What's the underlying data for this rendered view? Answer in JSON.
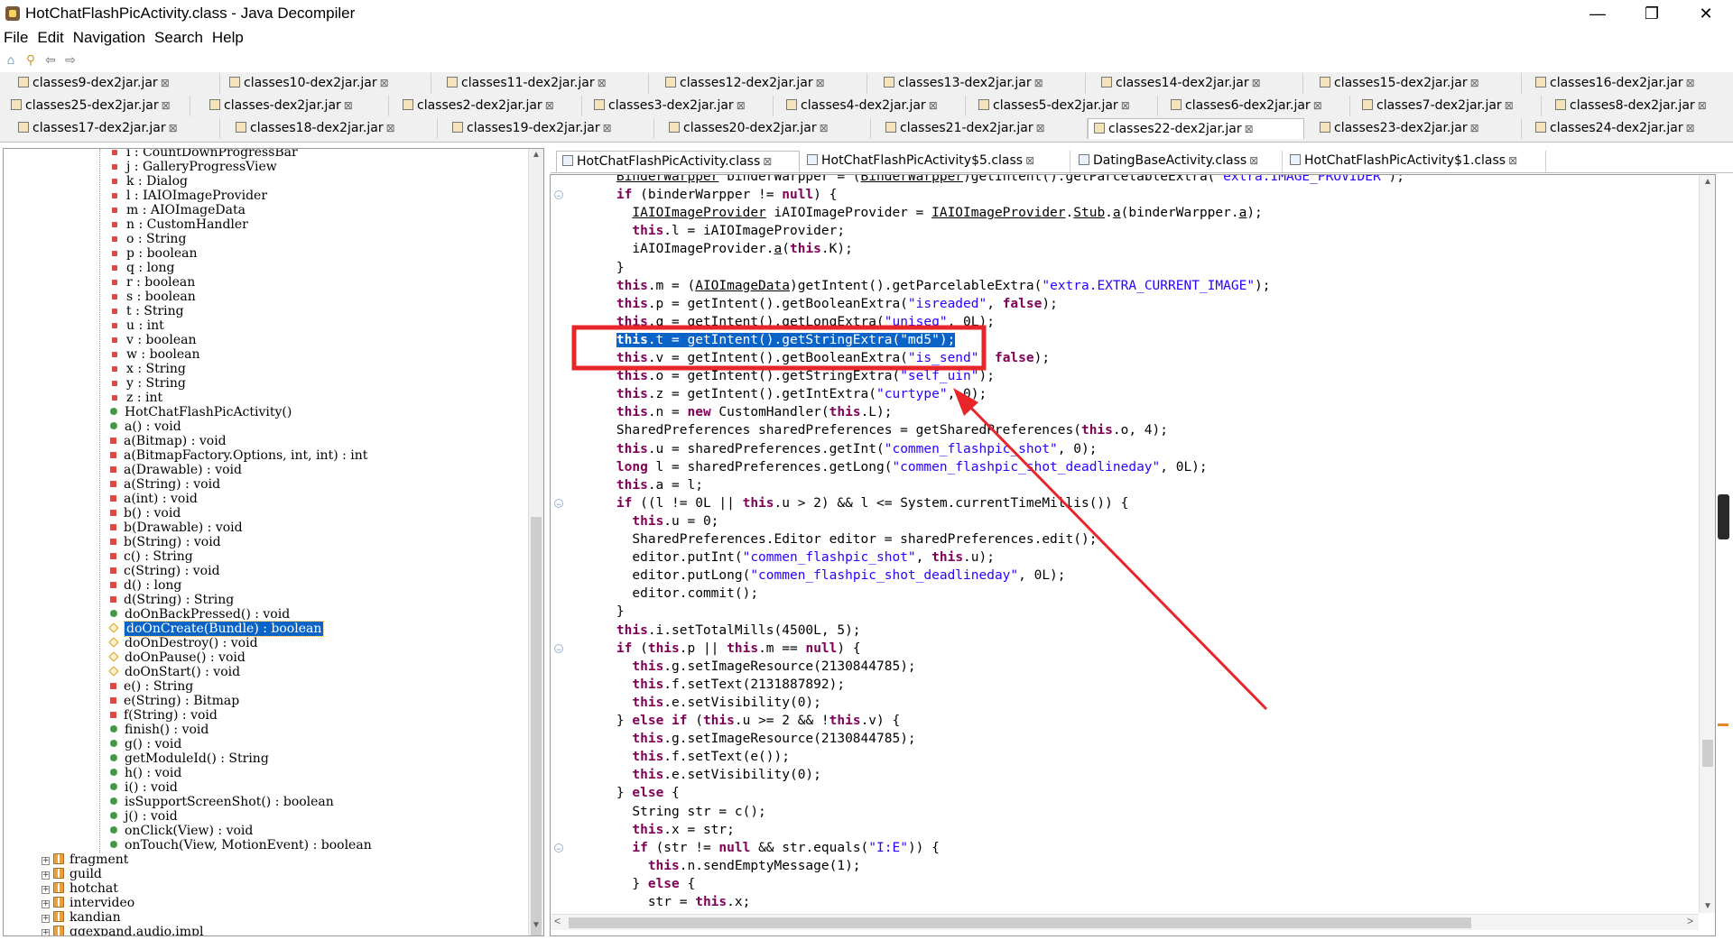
{
  "window": {
    "title": "HotChatFlashPicActivity.class - Java Decompiler",
    "minimize": "—",
    "maximize": "❐",
    "close": "✕"
  },
  "menu": [
    "File",
    "Edit",
    "Navigation",
    "Search",
    "Help"
  ],
  "toolbar": {
    "icons": [
      "open-file-icon",
      "open-folder-icon",
      "back-icon",
      "forward-icon"
    ],
    "glyphs": [
      "⌂",
      "⚲",
      "⇦",
      "⇨"
    ]
  },
  "jar_tabs": {
    "row1": [
      "classes9-dex2jar.jar",
      "classes10-dex2jar.jar",
      "classes11-dex2jar.jar",
      "classes12-dex2jar.jar",
      "classes13-dex2jar.jar",
      "classes14-dex2jar.jar",
      "classes15-dex2jar.jar",
      "classes16-dex2jar.jar"
    ],
    "row2": [
      "classes25-dex2jar.jar",
      "classes-dex2jar.jar",
      "classes2-dex2jar.jar",
      "classes3-dex2jar.jar",
      "classes4-dex2jar.jar",
      "classes5-dex2jar.jar",
      "classes6-dex2jar.jar",
      "classes7-dex2jar.jar",
      "classes8-dex2jar.jar"
    ],
    "row3": [
      "classes17-dex2jar.jar",
      "classes18-dex2jar.jar",
      "classes19-dex2jar.jar",
      "classes20-dex2jar.jar",
      "classes21-dex2jar.jar",
      "classes22-dex2jar.jar",
      "classes23-dex2jar.jar",
      "classes24-dex2jar.jar"
    ],
    "active": "classes22-dex2jar.jar",
    "close_glyph": "⊠"
  },
  "tree": {
    "members": [
      {
        "kind": "field",
        "text": "i : CountDownProgressBar"
      },
      {
        "kind": "field",
        "text": "j : GalleryProgressView"
      },
      {
        "kind": "field",
        "text": "k : Dialog"
      },
      {
        "kind": "field",
        "text": "l : IAIOImageProvider"
      },
      {
        "kind": "field",
        "text": "m : AIOImageData"
      },
      {
        "kind": "field",
        "text": "n : CustomHandler"
      },
      {
        "kind": "field",
        "text": "o : String"
      },
      {
        "kind": "field",
        "text": "p : boolean"
      },
      {
        "kind": "field",
        "text": "q : long"
      },
      {
        "kind": "field",
        "text": "r : boolean"
      },
      {
        "kind": "field",
        "text": "s : boolean"
      },
      {
        "kind": "field",
        "text": "t : String"
      },
      {
        "kind": "field",
        "text": "u : int"
      },
      {
        "kind": "field",
        "text": "v : boolean"
      },
      {
        "kind": "field",
        "text": "w : boolean"
      },
      {
        "kind": "field",
        "text": "x : String"
      },
      {
        "kind": "field",
        "text": "y : String"
      },
      {
        "kind": "field",
        "text": "z : int"
      },
      {
        "kind": "pub",
        "text": "HotChatFlashPicActivity()"
      },
      {
        "kind": "pub",
        "text": "a() : void"
      },
      {
        "kind": "priv",
        "text": "a(Bitmap) : void"
      },
      {
        "kind": "priv",
        "text": "a(BitmapFactory.Options, int, int) : int"
      },
      {
        "kind": "priv",
        "text": "a(Drawable) : void"
      },
      {
        "kind": "priv",
        "text": "a(String) : void"
      },
      {
        "kind": "priv",
        "text": "a(int) : void"
      },
      {
        "kind": "priv",
        "text": "b() : void"
      },
      {
        "kind": "priv",
        "text": "b(Drawable) : void"
      },
      {
        "kind": "priv",
        "text": "b(String) : void"
      },
      {
        "kind": "priv",
        "text": "c() : String"
      },
      {
        "kind": "priv",
        "text": "c(String) : void"
      },
      {
        "kind": "priv",
        "text": "d() : long"
      },
      {
        "kind": "priv",
        "text": "d(String) : String"
      },
      {
        "kind": "pub",
        "text": "doOnBackPressed() : void"
      },
      {
        "kind": "prot",
        "text": "doOnCreate(Bundle) : boolean",
        "selected": true
      },
      {
        "kind": "prot",
        "text": "doOnDestroy() : void"
      },
      {
        "kind": "prot",
        "text": "doOnPause() : void"
      },
      {
        "kind": "prot",
        "text": "doOnStart() : void"
      },
      {
        "kind": "priv",
        "text": "e() : String"
      },
      {
        "kind": "priv",
        "text": "e(String) : Bitmap"
      },
      {
        "kind": "priv",
        "text": "f(String) : void"
      },
      {
        "kind": "pub",
        "text": "finish() : void"
      },
      {
        "kind": "pub",
        "text": "g() : void"
      },
      {
        "kind": "pub",
        "text": "getModuleId() : String"
      },
      {
        "kind": "pub",
        "text": "h() : void"
      },
      {
        "kind": "pub",
        "text": "i() : void"
      },
      {
        "kind": "pub",
        "text": "isSupportScreenShot() : boolean"
      },
      {
        "kind": "pub",
        "text": "j() : void"
      },
      {
        "kind": "pub",
        "text": "onClick(View) : void"
      },
      {
        "kind": "pub",
        "text": "onTouch(View, MotionEvent) : boolean"
      }
    ],
    "packages": [
      "fragment",
      "guild",
      "hotchat",
      "intervideo",
      "kandian",
      "qqexpand.audio.impl"
    ],
    "expander": "+"
  },
  "editor_tabs": [
    {
      "label": "HotChatFlashPicActivity.class",
      "active": true
    },
    {
      "label": "HotChatFlashPicActivity$5.class",
      "active": false
    },
    {
      "label": "DatingBaseActivity.class",
      "active": false
    },
    {
      "label": "HotChatFlashPicActivity$1.class",
      "active": false
    }
  ],
  "code": [
    {
      "indent": 4,
      "fold": false,
      "html": "<span class=\"ul\">BinderWarpper</span> binderWarpper = (<span class=\"ul\">BinderWarpper</span>)getIntent().getParcelableExtra(<span class=\"str\">\"extra.IMAGE_PROVIDER\"</span>);"
    },
    {
      "indent": 4,
      "fold": true,
      "html": "<span class=\"kw\">if</span> (binderWarpper != <span class=\"kw\">null</span>) {"
    },
    {
      "indent": 6,
      "fold": false,
      "html": "<span class=\"ul\">IAIOImageProvider</span> iAIOImageProvider = <span class=\"ul\">IAIOImageProvider</span>.<span class=\"ul\">Stub</span>.<span class=\"ul\">a</span>(binderWarpper.<span class=\"ul\">a</span>);"
    },
    {
      "indent": 6,
      "fold": false,
      "html": "<span class=\"kw\">this</span>.l = iAIOImageProvider;"
    },
    {
      "indent": 6,
      "fold": false,
      "html": "iAIOImageProvider.<span class=\"ul\">a</span>(<span class=\"kw\">this</span>.K);"
    },
    {
      "indent": 4,
      "fold": false,
      "html": "}"
    },
    {
      "indent": 4,
      "fold": false,
      "html": "<span class=\"kw\">this</span>.m = (<span class=\"ul\">AIOImageData</span>)getIntent().getParcelableExtra(<span class=\"str\">\"extra.EXTRA_CURRENT_IMAGE\"</span>);"
    },
    {
      "indent": 4,
      "fold": false,
      "html": "<span class=\"kw\">this</span>.p = getIntent().getBooleanExtra(<span class=\"str\">\"isreaded\"</span>, <span class=\"kw\">false</span>);"
    },
    {
      "indent": 4,
      "fold": false,
      "html": "<span class=\"kw\">this</span>.q = getIntent().getLongExtra(<span class=\"str\">\"uniseq\"</span>, 0L);"
    },
    {
      "indent": 4,
      "fold": false,
      "sel": true,
      "html": "<span class=\"sel-span\"><span class=\"kw\">this</span>.t = getIntent().getStringExtra(<span class=\"str\">\"md5\"</span>);</span>"
    },
    {
      "indent": 4,
      "fold": false,
      "html": "<span class=\"kw\">this</span>.v = getIntent().getBooleanExtra(<span class=\"str\">\"is_send\"</span>, <span class=\"kw\">false</span>);"
    },
    {
      "indent": 4,
      "fold": false,
      "html": "<span class=\"kw\">this</span>.o = getIntent().getStringExtra(<span class=\"str\">\"self_uin\"</span>);"
    },
    {
      "indent": 4,
      "fold": false,
      "html": "<span class=\"kw\">this</span>.z = getIntent().getIntExtra(<span class=\"str\">\"curtype\"</span>, 0);"
    },
    {
      "indent": 4,
      "fold": false,
      "html": "<span class=\"kw\">this</span>.n = <span class=\"kw\">new</span> CustomHandler(<span class=\"kw\">this</span>.L);"
    },
    {
      "indent": 4,
      "fold": false,
      "html": "SharedPreferences sharedPreferences = getSharedPreferences(<span class=\"kw\">this</span>.o, 4);"
    },
    {
      "indent": 4,
      "fold": false,
      "html": "<span class=\"kw\">this</span>.u = sharedPreferences.getInt(<span class=\"str\">\"commen_flashpic_shot\"</span>, 0);"
    },
    {
      "indent": 4,
      "fold": false,
      "html": "<span class=\"kw\">long</span> l = sharedPreferences.getLong(<span class=\"str\">\"commen_flashpic_shot_deadlineday\"</span>, 0L);"
    },
    {
      "indent": 4,
      "fold": false,
      "html": "<span class=\"kw\">this</span>.a = l;"
    },
    {
      "indent": 4,
      "fold": true,
      "html": "<span class=\"kw\">if</span> ((l != 0L || <span class=\"kw\">this</span>.u > 2) && l <= System.currentTimeMillis()) {"
    },
    {
      "indent": 6,
      "fold": false,
      "html": "<span class=\"kw\">this</span>.u = 0;"
    },
    {
      "indent": 6,
      "fold": false,
      "html": "SharedPreferences.Editor editor = sharedPreferences.edit();"
    },
    {
      "indent": 6,
      "fold": false,
      "html": "editor.putInt(<span class=\"str\">\"commen_flashpic_shot\"</span>, <span class=\"kw\">this</span>.u);"
    },
    {
      "indent": 6,
      "fold": false,
      "html": "editor.putLong(<span class=\"str\">\"commen_flashpic_shot_deadlineday\"</span>, 0L);"
    },
    {
      "indent": 6,
      "fold": false,
      "html": "editor.commit();"
    },
    {
      "indent": 4,
      "fold": false,
      "html": "}"
    },
    {
      "indent": 4,
      "fold": false,
      "html": "<span class=\"kw\">this</span>.i.setTotalMills(4500L, 5);"
    },
    {
      "indent": 4,
      "fold": true,
      "html": "<span class=\"kw\">if</span> (<span class=\"kw\">this</span>.p || <span class=\"kw\">this</span>.m == <span class=\"kw\">null</span>) {"
    },
    {
      "indent": 6,
      "fold": false,
      "html": "<span class=\"kw\">this</span>.g.setImageResource(2130844785);"
    },
    {
      "indent": 6,
      "fold": false,
      "html": "<span class=\"kw\">this</span>.f.setText(2131887892);"
    },
    {
      "indent": 6,
      "fold": false,
      "html": "<span class=\"kw\">this</span>.e.setVisibility(0);"
    },
    {
      "indent": 4,
      "fold": false,
      "html": "} <span class=\"kw\">else if</span> (<span class=\"kw\">this</span>.u >= 2 && !<span class=\"kw\">this</span>.v) {"
    },
    {
      "indent": 6,
      "fold": false,
      "html": "<span class=\"kw\">this</span>.g.setImageResource(2130844785);"
    },
    {
      "indent": 6,
      "fold": false,
      "html": "<span class=\"kw\">this</span>.f.setText(e());"
    },
    {
      "indent": 6,
      "fold": false,
      "html": "<span class=\"kw\">this</span>.e.setVisibility(0);"
    },
    {
      "indent": 4,
      "fold": false,
      "html": "} <span class=\"kw\">else</span> {"
    },
    {
      "indent": 6,
      "fold": false,
      "html": "String str = c();"
    },
    {
      "indent": 6,
      "fold": false,
      "html": "<span class=\"kw\">this</span>.x = str;"
    },
    {
      "indent": 6,
      "fold": true,
      "html": "<span class=\"kw\">if</span> (str != <span class=\"kw\">null</span> && str.equals(<span class=\"str\">\"I:E\"</span>)) {"
    },
    {
      "indent": 8,
      "fold": false,
      "html": "<span class=\"kw\">this</span>.n.sendEmptyMessage(1);"
    },
    {
      "indent": 6,
      "fold": false,
      "html": "} <span class=\"kw\">else</span> {"
    },
    {
      "indent": 8,
      "fold": false,
      "html": "str = <span class=\"kw\">this</span>.x;"
    }
  ],
  "colors": {
    "annotation_red": "#e8262a",
    "selection_blue": "#0a64c8",
    "keyword": "#7f0055",
    "string": "#2a00ff"
  },
  "scroll_glyphs": {
    "up": "▲",
    "down": "▼",
    "left": "<",
    "right": ">"
  }
}
